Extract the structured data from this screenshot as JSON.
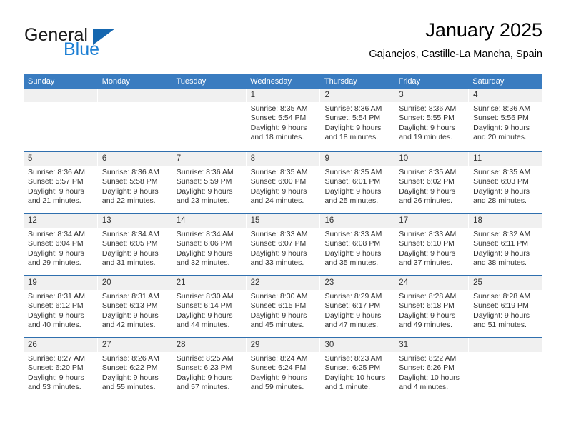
{
  "brand": {
    "name_part1": "General",
    "name_part2": "Blue",
    "accent_color": "#1c7fd4",
    "triangle_color": "#1567b0"
  },
  "header": {
    "title": "January 2025",
    "subtitle": "Gajanejos, Castille-La Mancha, Spain"
  },
  "calendar": {
    "header_bg": "#3a7cc0",
    "row_divider_color": "#2f6fae",
    "daynum_bg": "#f0f0f0",
    "weekdays": [
      "Sunday",
      "Monday",
      "Tuesday",
      "Wednesday",
      "Thursday",
      "Friday",
      "Saturday"
    ],
    "weeks": [
      [
        {
          "empty": true
        },
        {
          "empty": true
        },
        {
          "empty": true
        },
        {
          "day": "1",
          "sunrise": "Sunrise: 8:35 AM",
          "sunset": "Sunset: 5:54 PM",
          "daylight1": "Daylight: 9 hours",
          "daylight2": "and 18 minutes."
        },
        {
          "day": "2",
          "sunrise": "Sunrise: 8:36 AM",
          "sunset": "Sunset: 5:54 PM",
          "daylight1": "Daylight: 9 hours",
          "daylight2": "and 18 minutes."
        },
        {
          "day": "3",
          "sunrise": "Sunrise: 8:36 AM",
          "sunset": "Sunset: 5:55 PM",
          "daylight1": "Daylight: 9 hours",
          "daylight2": "and 19 minutes."
        },
        {
          "day": "4",
          "sunrise": "Sunrise: 8:36 AM",
          "sunset": "Sunset: 5:56 PM",
          "daylight1": "Daylight: 9 hours",
          "daylight2": "and 20 minutes."
        }
      ],
      [
        {
          "day": "5",
          "sunrise": "Sunrise: 8:36 AM",
          "sunset": "Sunset: 5:57 PM",
          "daylight1": "Daylight: 9 hours",
          "daylight2": "and 21 minutes."
        },
        {
          "day": "6",
          "sunrise": "Sunrise: 8:36 AM",
          "sunset": "Sunset: 5:58 PM",
          "daylight1": "Daylight: 9 hours",
          "daylight2": "and 22 minutes."
        },
        {
          "day": "7",
          "sunrise": "Sunrise: 8:36 AM",
          "sunset": "Sunset: 5:59 PM",
          "daylight1": "Daylight: 9 hours",
          "daylight2": "and 23 minutes."
        },
        {
          "day": "8",
          "sunrise": "Sunrise: 8:35 AM",
          "sunset": "Sunset: 6:00 PM",
          "daylight1": "Daylight: 9 hours",
          "daylight2": "and 24 minutes."
        },
        {
          "day": "9",
          "sunrise": "Sunrise: 8:35 AM",
          "sunset": "Sunset: 6:01 PM",
          "daylight1": "Daylight: 9 hours",
          "daylight2": "and 25 minutes."
        },
        {
          "day": "10",
          "sunrise": "Sunrise: 8:35 AM",
          "sunset": "Sunset: 6:02 PM",
          "daylight1": "Daylight: 9 hours",
          "daylight2": "and 26 minutes."
        },
        {
          "day": "11",
          "sunrise": "Sunrise: 8:35 AM",
          "sunset": "Sunset: 6:03 PM",
          "daylight1": "Daylight: 9 hours",
          "daylight2": "and 28 minutes."
        }
      ],
      [
        {
          "day": "12",
          "sunrise": "Sunrise: 8:34 AM",
          "sunset": "Sunset: 6:04 PM",
          "daylight1": "Daylight: 9 hours",
          "daylight2": "and 29 minutes."
        },
        {
          "day": "13",
          "sunrise": "Sunrise: 8:34 AM",
          "sunset": "Sunset: 6:05 PM",
          "daylight1": "Daylight: 9 hours",
          "daylight2": "and 31 minutes."
        },
        {
          "day": "14",
          "sunrise": "Sunrise: 8:34 AM",
          "sunset": "Sunset: 6:06 PM",
          "daylight1": "Daylight: 9 hours",
          "daylight2": "and 32 minutes."
        },
        {
          "day": "15",
          "sunrise": "Sunrise: 8:33 AM",
          "sunset": "Sunset: 6:07 PM",
          "daylight1": "Daylight: 9 hours",
          "daylight2": "and 33 minutes."
        },
        {
          "day": "16",
          "sunrise": "Sunrise: 8:33 AM",
          "sunset": "Sunset: 6:08 PM",
          "daylight1": "Daylight: 9 hours",
          "daylight2": "and 35 minutes."
        },
        {
          "day": "17",
          "sunrise": "Sunrise: 8:33 AM",
          "sunset": "Sunset: 6:10 PM",
          "daylight1": "Daylight: 9 hours",
          "daylight2": "and 37 minutes."
        },
        {
          "day": "18",
          "sunrise": "Sunrise: 8:32 AM",
          "sunset": "Sunset: 6:11 PM",
          "daylight1": "Daylight: 9 hours",
          "daylight2": "and 38 minutes."
        }
      ],
      [
        {
          "day": "19",
          "sunrise": "Sunrise: 8:31 AM",
          "sunset": "Sunset: 6:12 PM",
          "daylight1": "Daylight: 9 hours",
          "daylight2": "and 40 minutes."
        },
        {
          "day": "20",
          "sunrise": "Sunrise: 8:31 AM",
          "sunset": "Sunset: 6:13 PM",
          "daylight1": "Daylight: 9 hours",
          "daylight2": "and 42 minutes."
        },
        {
          "day": "21",
          "sunrise": "Sunrise: 8:30 AM",
          "sunset": "Sunset: 6:14 PM",
          "daylight1": "Daylight: 9 hours",
          "daylight2": "and 44 minutes."
        },
        {
          "day": "22",
          "sunrise": "Sunrise: 8:30 AM",
          "sunset": "Sunset: 6:15 PM",
          "daylight1": "Daylight: 9 hours",
          "daylight2": "and 45 minutes."
        },
        {
          "day": "23",
          "sunrise": "Sunrise: 8:29 AM",
          "sunset": "Sunset: 6:17 PM",
          "daylight1": "Daylight: 9 hours",
          "daylight2": "and 47 minutes."
        },
        {
          "day": "24",
          "sunrise": "Sunrise: 8:28 AM",
          "sunset": "Sunset: 6:18 PM",
          "daylight1": "Daylight: 9 hours",
          "daylight2": "and 49 minutes."
        },
        {
          "day": "25",
          "sunrise": "Sunrise: 8:28 AM",
          "sunset": "Sunset: 6:19 PM",
          "daylight1": "Daylight: 9 hours",
          "daylight2": "and 51 minutes."
        }
      ],
      [
        {
          "day": "26",
          "sunrise": "Sunrise: 8:27 AM",
          "sunset": "Sunset: 6:20 PM",
          "daylight1": "Daylight: 9 hours",
          "daylight2": "and 53 minutes."
        },
        {
          "day": "27",
          "sunrise": "Sunrise: 8:26 AM",
          "sunset": "Sunset: 6:22 PM",
          "daylight1": "Daylight: 9 hours",
          "daylight2": "and 55 minutes."
        },
        {
          "day": "28",
          "sunrise": "Sunrise: 8:25 AM",
          "sunset": "Sunset: 6:23 PM",
          "daylight1": "Daylight: 9 hours",
          "daylight2": "and 57 minutes."
        },
        {
          "day": "29",
          "sunrise": "Sunrise: 8:24 AM",
          "sunset": "Sunset: 6:24 PM",
          "daylight1": "Daylight: 9 hours",
          "daylight2": "and 59 minutes."
        },
        {
          "day": "30",
          "sunrise": "Sunrise: 8:23 AM",
          "sunset": "Sunset: 6:25 PM",
          "daylight1": "Daylight: 10 hours",
          "daylight2": "and 1 minute."
        },
        {
          "day": "31",
          "sunrise": "Sunrise: 8:22 AM",
          "sunset": "Sunset: 6:26 PM",
          "daylight1": "Daylight: 10 hours",
          "daylight2": "and 4 minutes."
        },
        {
          "empty": true
        }
      ]
    ]
  }
}
